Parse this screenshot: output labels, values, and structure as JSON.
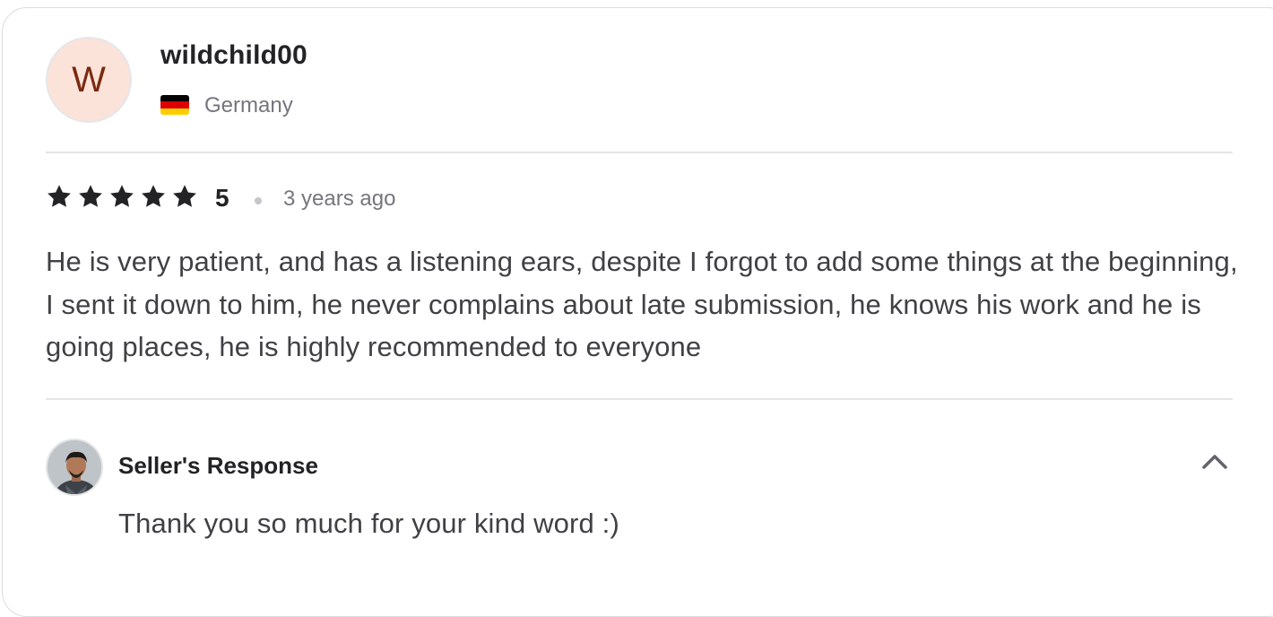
{
  "reviewer": {
    "avatar_initial": "W",
    "avatar_bg": "#fbe3da",
    "avatar_fg": "#7a2a10",
    "username": "wildchild00",
    "country": "Germany",
    "flag_icon": "germany-flag-icon",
    "flag_colors": [
      "#000000",
      "#dd0000",
      "#ffce00"
    ]
  },
  "rating": {
    "stars": 5,
    "max_stars": 5,
    "value_label": "5",
    "star_icon": "star-icon",
    "star_color": "#222325",
    "time_ago": "3 years ago"
  },
  "review_text": "He is very patient, and has a listening ears, despite I forgot to add some things at the beginning, I sent it down to him, he never complains about late submission, he knows his work and he is going places, he is highly recommended to everyone",
  "seller_response": {
    "title": "Seller's Response",
    "avatar_icon": "seller-avatar",
    "toggle_icon": "chevron-up-icon",
    "text": "Thank you so much for your kind word :)"
  }
}
